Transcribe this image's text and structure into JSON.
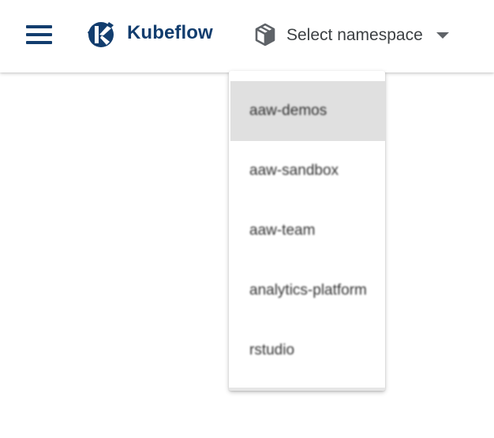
{
  "app": {
    "brand": "Kubeflow",
    "brand_color": "#123d6e"
  },
  "header": {
    "menu_icon": "hamburger-menu-icon",
    "logo_icon": "kubeflow-logo-icon",
    "namespace_selector": {
      "icon": "cube-box-icon",
      "label": "Select namespace",
      "caret_icon": "caret-down-icon"
    }
  },
  "dropdown": {
    "selected_index": 0,
    "selected_bg": "#e0e0e0",
    "items": [
      {
        "label": "aaw-demos"
      },
      {
        "label": "aaw-sandbox"
      },
      {
        "label": "aaw-team"
      },
      {
        "label": "analytics-platform"
      },
      {
        "label": "rstudio"
      }
    ]
  }
}
